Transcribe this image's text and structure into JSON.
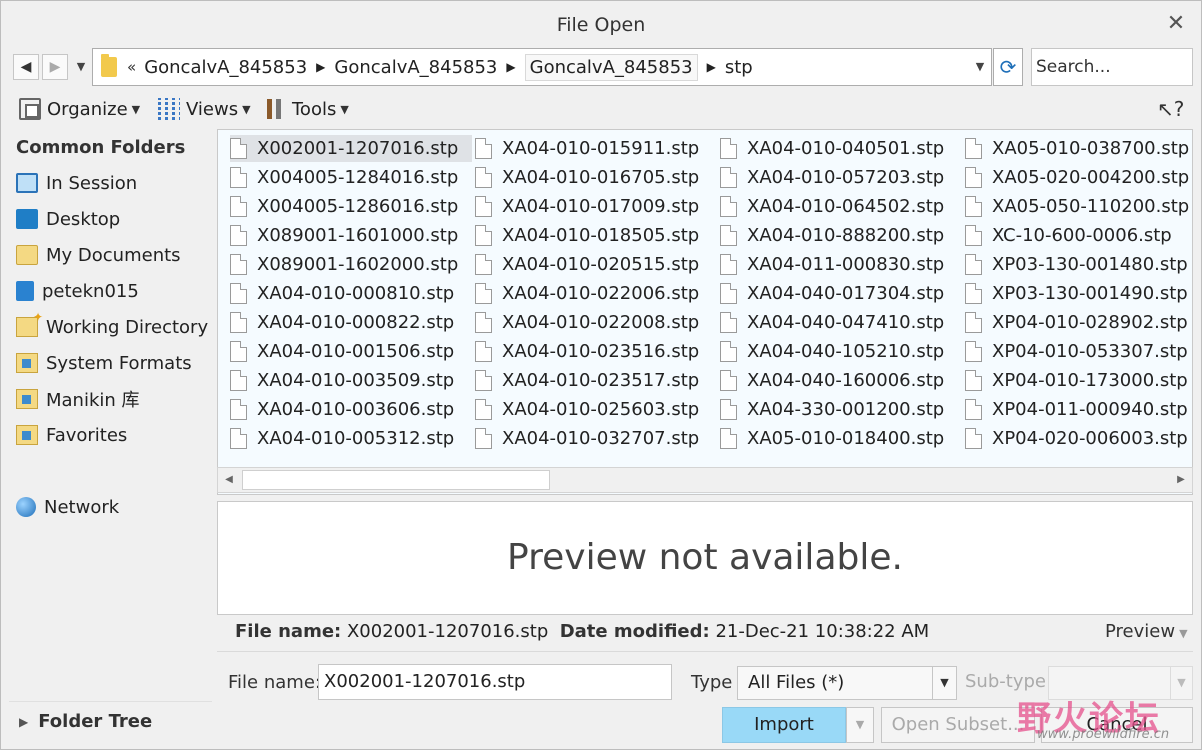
{
  "window": {
    "title": "File Open"
  },
  "address": {
    "crumbs": [
      "GoncalvA_845853",
      "GoncalvA_845853",
      "GoncalvA_845853",
      "stp"
    ],
    "search_placeholder": "Search..."
  },
  "toolbar": {
    "organize": "Organize",
    "views": "Views",
    "tools": "Tools"
  },
  "sidebar": {
    "heading": "Common Folders",
    "items": [
      {
        "label": "In Session",
        "icon": "monitor-icon"
      },
      {
        "label": "Desktop",
        "icon": "desktop-icon"
      },
      {
        "label": "My Documents",
        "icon": "documents-icon"
      },
      {
        "label": "petekn015",
        "icon": "computer-icon"
      },
      {
        "label": "Working Directory",
        "icon": "working-directory-icon"
      },
      {
        "label": "System Formats",
        "icon": "folder-icon"
      },
      {
        "label": "Manikin 库",
        "icon": "folder-icon"
      },
      {
        "label": "Favorites",
        "icon": "favorites-icon"
      }
    ],
    "network": "Network",
    "folder_tree": "Folder Tree"
  },
  "files": {
    "columns": [
      [
        "X002001-1207016.stp",
        "X004005-1284016.stp",
        "X004005-1286016.stp",
        "X089001-1601000.stp",
        "X089001-1602000.stp",
        "XA04-010-000810.stp",
        "XA04-010-000822.stp",
        "XA04-010-001506.stp",
        "XA04-010-003509.stp",
        "XA04-010-003606.stp",
        "XA04-010-005312.stp"
      ],
      [
        "XA04-010-015911.stp",
        "XA04-010-016705.stp",
        "XA04-010-017009.stp",
        "XA04-010-018505.stp",
        "XA04-010-020515.stp",
        "XA04-010-022006.stp",
        "XA04-010-022008.stp",
        "XA04-010-023516.stp",
        "XA04-010-023517.stp",
        "XA04-010-025603.stp",
        "XA04-010-032707.stp"
      ],
      [
        "XA04-010-040501.stp",
        "XA04-010-057203.stp",
        "XA04-010-064502.stp",
        "XA04-010-888200.stp",
        "XA04-011-000830.stp",
        "XA04-040-017304.stp",
        "XA04-040-047410.stp",
        "XA04-040-105210.stp",
        "XA04-040-160006.stp",
        "XA04-330-001200.stp",
        "XA05-010-018400.stp"
      ],
      [
        "XA05-010-038700.stp",
        "XA05-020-004200.stp",
        "XA05-050-110200.stp",
        "XC-10-600-0006.stp",
        "XP03-130-001480.stp",
        "XP03-130-001490.stp",
        "XP04-010-028902.stp",
        "XP04-010-053307.stp",
        "XP04-010-173000.stp",
        "XP04-011-000940.stp",
        "XP04-020-006003.stp"
      ]
    ],
    "selected": "X002001-1207016.stp"
  },
  "preview": {
    "message": "Preview not available.",
    "toggle_label": "Preview"
  },
  "info": {
    "file_name_label": "File name:",
    "file_name_value": "X002001-1207016.stp",
    "date_label": "Date modified:",
    "date_value": "21-Dec-21 10:38:22 AM"
  },
  "form": {
    "file_name_label": "File name:",
    "file_name_value": "X002001-1207016.stp",
    "type_label": "Type",
    "type_value": "All Files (*)",
    "subtype_label": "Sub-type"
  },
  "buttons": {
    "import": "Import",
    "open_subset": "Open Subset...",
    "cancel": "Cancel"
  },
  "watermark": {
    "text": "野火论坛",
    "url": "www.proewildfire.cn"
  },
  "colors": {
    "import_button": "#99d9f7",
    "file_area_bg": "#f5fbff",
    "selected_row": "#dfe2e6"
  }
}
